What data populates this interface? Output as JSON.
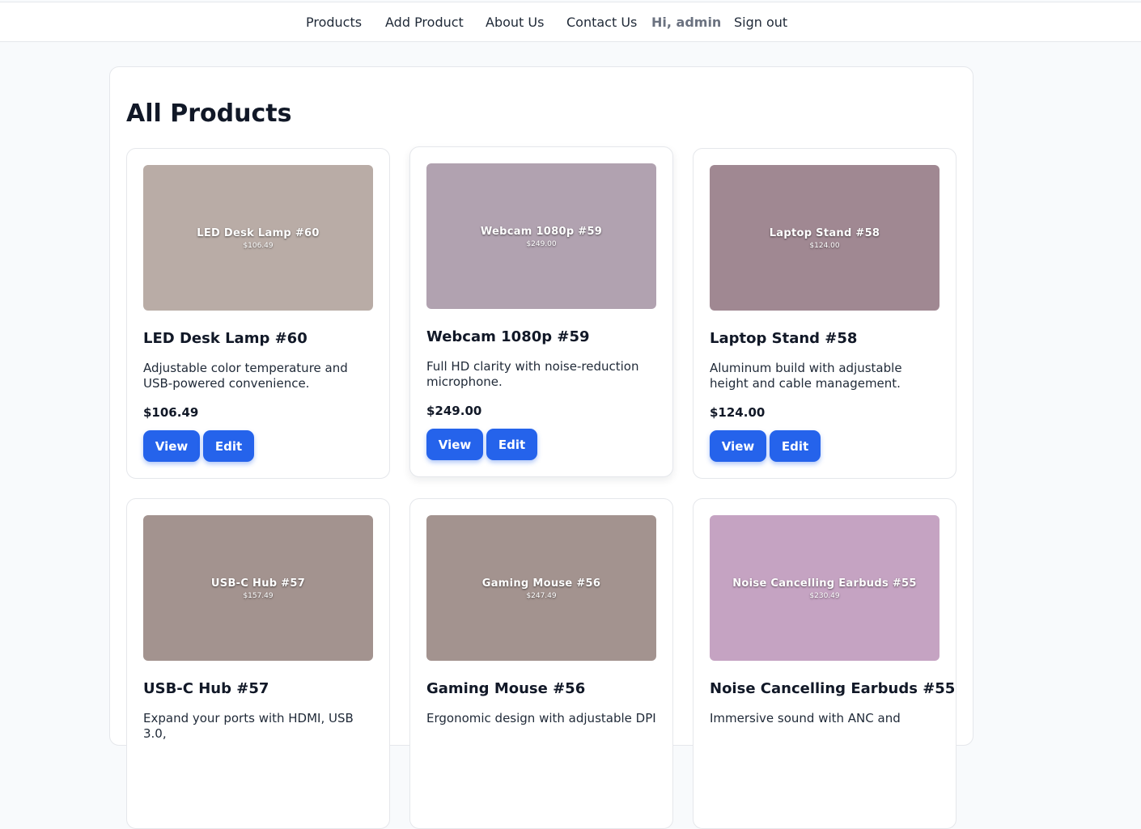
{
  "nav": {
    "items": [
      {
        "label": "Products"
      },
      {
        "label": "Add Product"
      },
      {
        "label": "About Us"
      },
      {
        "label": "Contact Us"
      }
    ],
    "greeting": "Hi, admin",
    "signout": "Sign out"
  },
  "page": {
    "title": "All Products"
  },
  "buttons": {
    "view": "View",
    "edit": "Edit"
  },
  "products": [
    {
      "name": "LED Desk Lamp #60",
      "image_title": "LED Desk Lamp #60",
      "image_price": "$106.49",
      "description": "Adjustable color temperature and USB-powered convenience.",
      "price": "$106.49",
      "image_color": "#b9aca6"
    },
    {
      "name": "Webcam 1080p #59",
      "image_title": "Webcam 1080p #59",
      "image_price": "$249.00",
      "description": "Full HD clarity with noise-reduction microphone.",
      "price": "$249.00",
      "image_color": "#b1a2b0"
    },
    {
      "name": "Laptop Stand #58",
      "image_title": "Laptop Stand #58",
      "image_price": "$124.00",
      "description": "Aluminum build with adjustable height and cable management.",
      "price": "$124.00",
      "image_color": "#a08892"
    },
    {
      "name": "USB-C Hub #57",
      "image_title": "USB-C Hub #57",
      "image_price": "$157.49",
      "description": "Expand your ports with HDMI, USB 3.0,",
      "price": "",
      "image_color": "#a3938f"
    },
    {
      "name": "Gaming Mouse #56",
      "image_title": "Gaming Mouse #56",
      "image_price": "$247.49",
      "description": "Ergonomic design with adjustable DPI",
      "price": "",
      "image_color": "#a3938f"
    },
    {
      "name": "Noise Cancelling Earbuds #55",
      "image_title": "Noise Cancelling Earbuds #55",
      "image_price": "$230.49",
      "description": "Immersive sound with ANC and",
      "price": "",
      "image_color": "#c5a3c2"
    }
  ]
}
